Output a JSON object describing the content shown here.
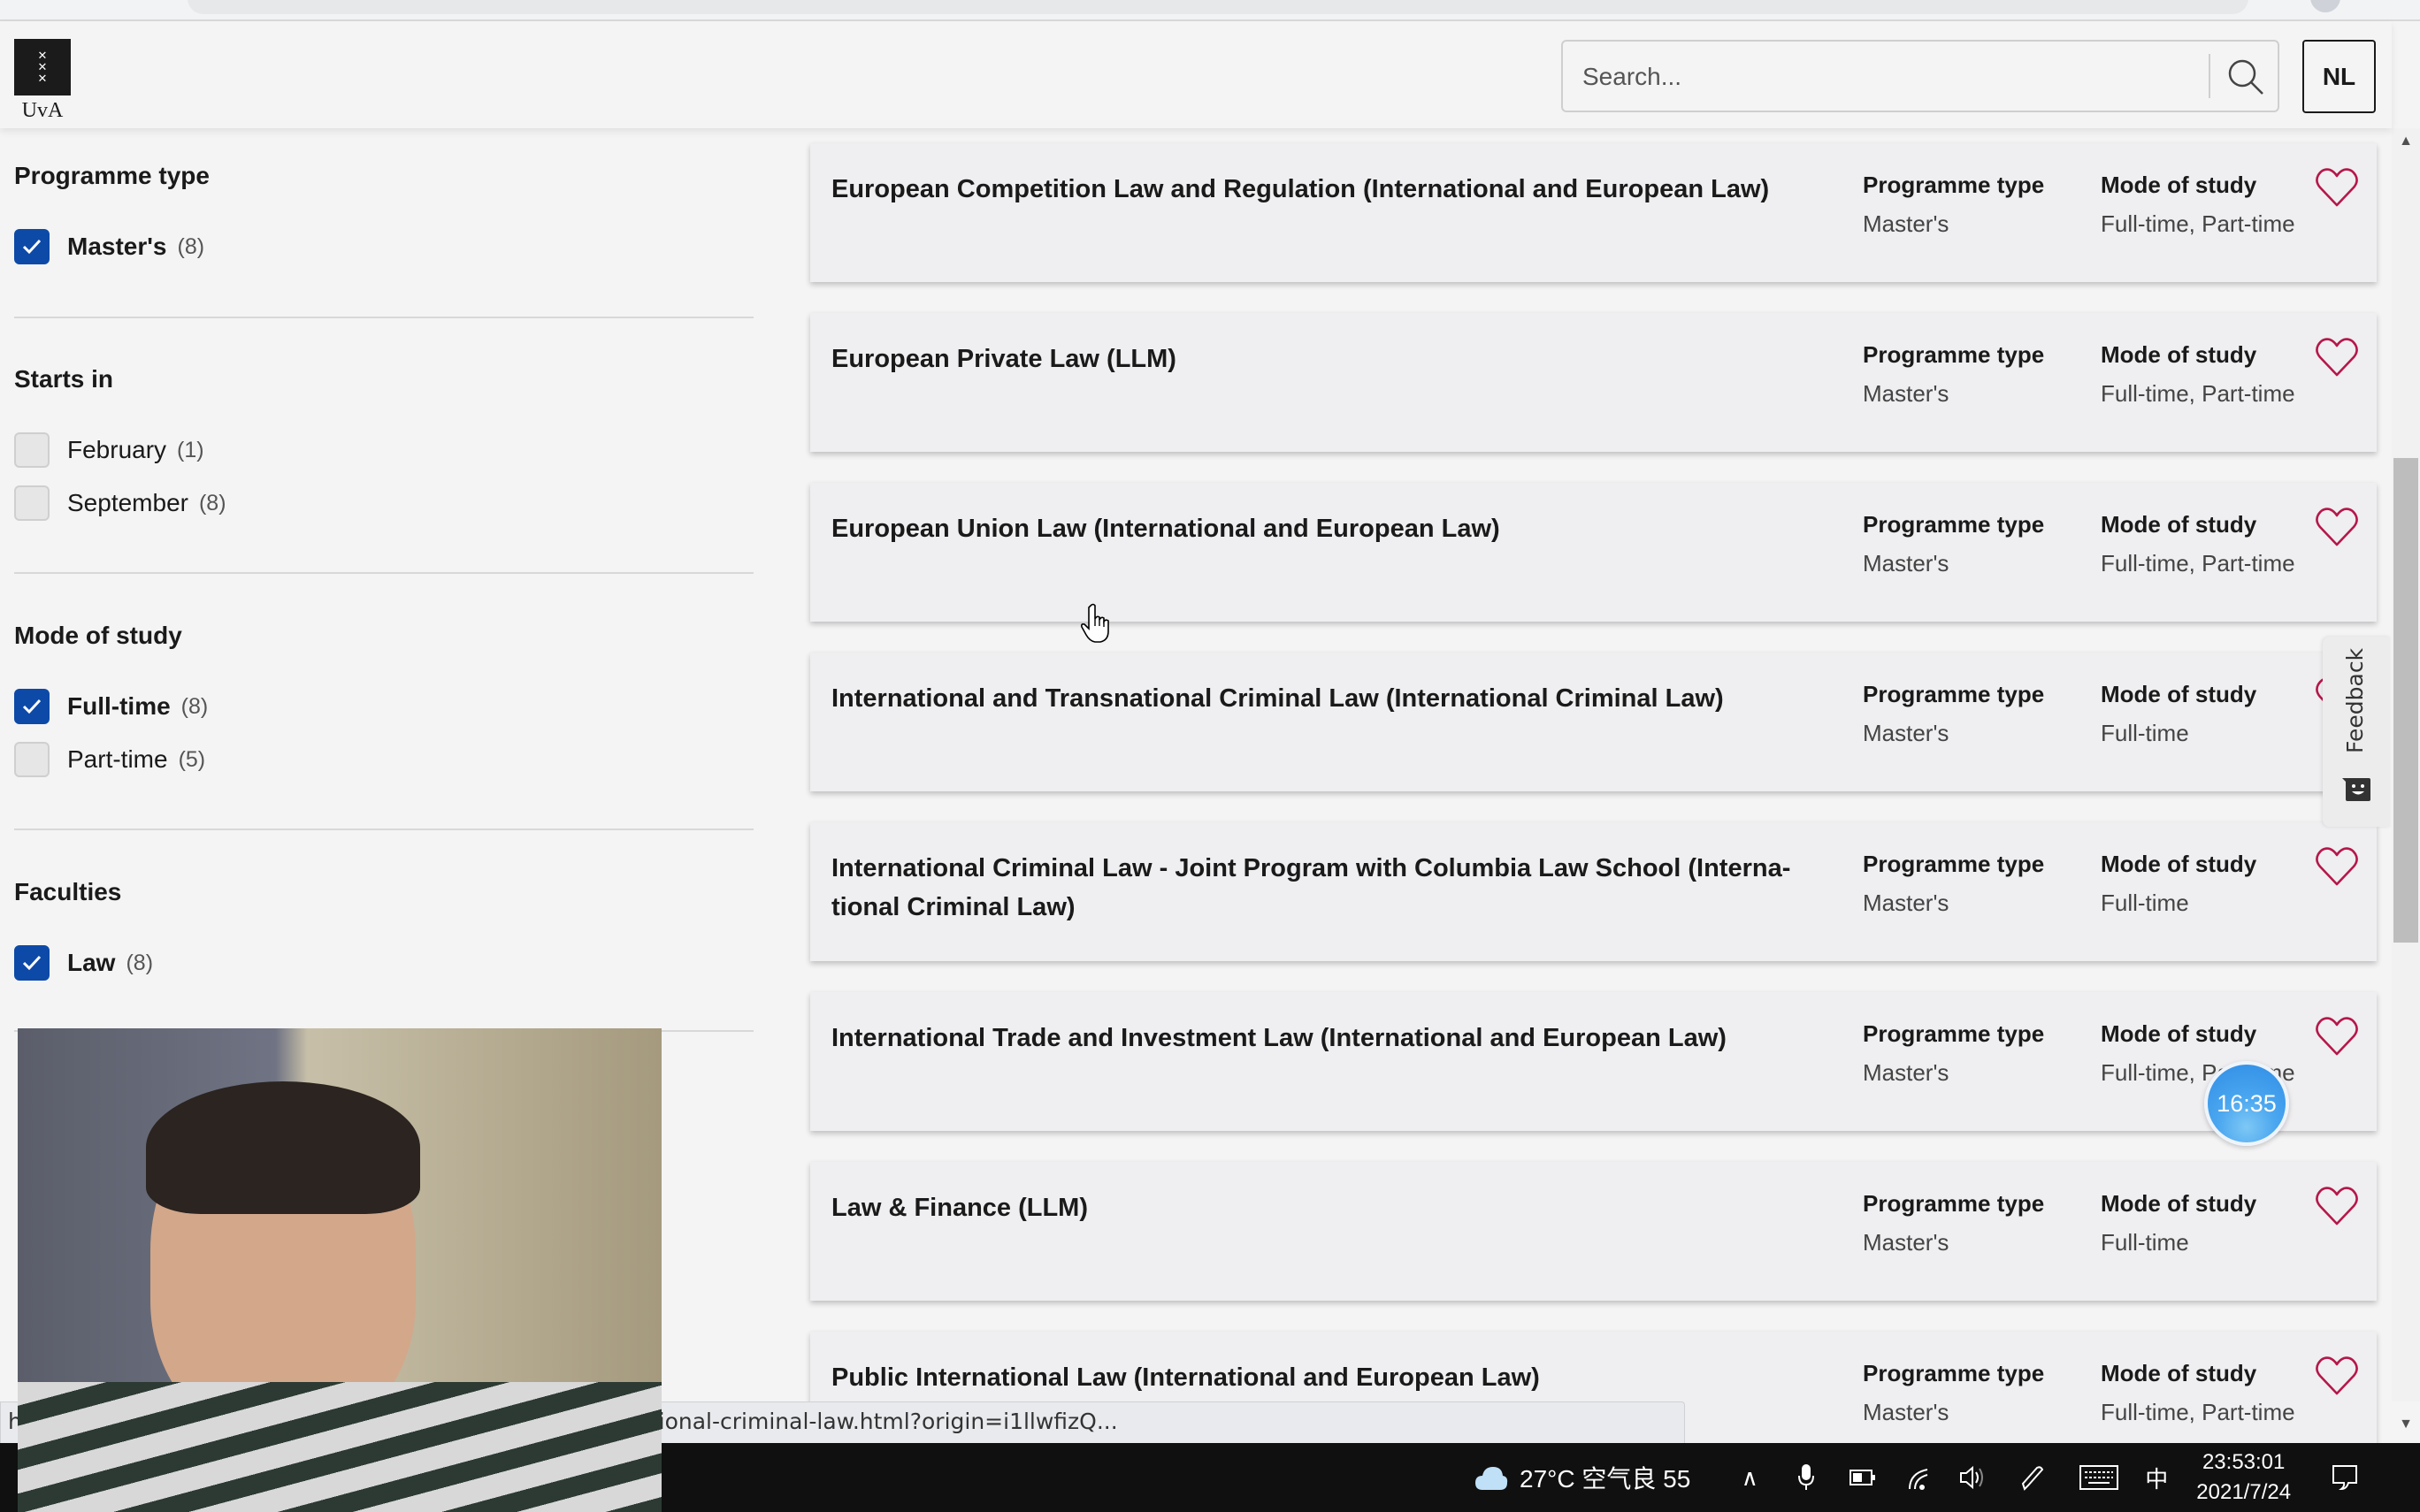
{
  "header": {
    "logo_text": "UvA",
    "search_placeholder": "Search...",
    "language_button": "NL"
  },
  "filters": [
    {
      "heading": "Programme type",
      "options": [
        {
          "label": "Master's",
          "count": "(8)",
          "checked": true
        }
      ]
    },
    {
      "heading": "Starts in",
      "options": [
        {
          "label": "February",
          "count": "(1)",
          "checked": false
        },
        {
          "label": "September",
          "count": "(8)",
          "checked": false
        }
      ]
    },
    {
      "heading": "Mode of study",
      "options": [
        {
          "label": "Full-time",
          "count": "(8)",
          "checked": true
        },
        {
          "label": "Part-time",
          "count": "(5)",
          "checked": false
        }
      ]
    },
    {
      "heading": "Faculties",
      "options": [
        {
          "label": "Law",
          "count": "(8)",
          "checked": true
        }
      ]
    }
  ],
  "results": {
    "col_programme_type": "Programme type",
    "col_mode_of_study": "Mode of study",
    "items": [
      {
        "title": "European Competition Law and Regulation (International and European Law)",
        "programme_type": "Master's",
        "mode_of_study": "Full-time, Part-time"
      },
      {
        "title": "European Private Law (LLM)",
        "programme_type": "Master's",
        "mode_of_study": "Full-time, Part-time"
      },
      {
        "title": "European Union Law (International and European Law)",
        "programme_type": "Master's",
        "mode_of_study": "Full-time, Part-time"
      },
      {
        "title": "International and Transnational Criminal Law (International Criminal Law)",
        "programme_type": "Master's",
        "mode_of_study": "Full-time"
      },
      {
        "title": "International Criminal Law - Joint Program with Columbia Law School (Interna-tional Criminal Law)",
        "programme_type": "Master's",
        "mode_of_study": "Full-time"
      },
      {
        "title": "International Trade and Investment Law (International and European Law)",
        "programme_type": "Master's",
        "mode_of_study": "Full-time, Part-time"
      },
      {
        "title": "Law & Finance (LLM)",
        "programme_type": "Master's",
        "mode_of_study": "Full-time"
      },
      {
        "title": "Public International Law (International and European Law)",
        "programme_type": "Master's",
        "mode_of_study": "Full-time, Part-time"
      }
    ]
  },
  "feedback_tab": {
    "label": "Feedback"
  },
  "timer_bubble": {
    "text": "16:35"
  },
  "status_bar": {
    "url_text": "h                               transnational-criminal-law-llm/international-and-transnational-criminal-law.html?origin=i1llwfizQ..."
  },
  "taskbar": {
    "weather": "27°C 空气良 55",
    "ime": "中",
    "time": "23:53:01",
    "date": "2021/7/24"
  },
  "colors": {
    "checkbox_checked": "#0d4aa8",
    "heart": "#b5174a",
    "timer_bubble": "#2f8de6"
  }
}
